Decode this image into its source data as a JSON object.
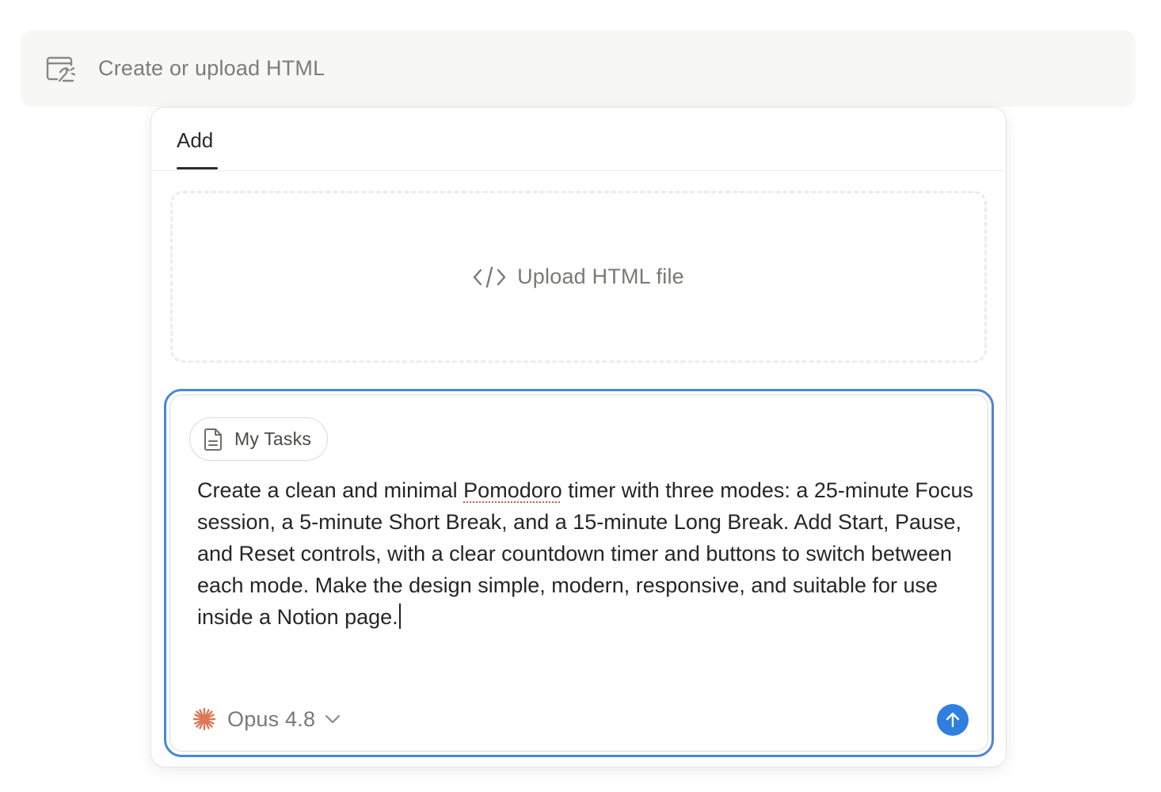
{
  "top_bar": {
    "icon": "html-embed-icon",
    "label": "Create or upload HTML"
  },
  "panel": {
    "tabs": [
      {
        "label": "Add",
        "active": true
      }
    ],
    "upload": {
      "icon": "code-icon",
      "label": "Upload HTML file"
    },
    "composer": {
      "context_chip": {
        "icon": "page-icon",
        "label": "My Tasks"
      },
      "prompt": {
        "before_spell": "Create a clean and minimal ",
        "spell_word": "Pomodoro",
        "after_spell": " timer with three modes: a 25-minute Focus session, a 5-minute Short Break, and a 15-minute Long Break. Add Start, Pause, and Reset controls, with a clear countdown timer and buttons to switch between each mode. Make the design simple, modern, responsive, and suitable for use inside a Notion page."
      },
      "model": {
        "icon": "sparkle-icon",
        "label": "Opus 4.8",
        "accent_color": "#d97757"
      },
      "send": {
        "icon": "arrow-up-icon",
        "color": "#2f7ee0"
      }
    }
  },
  "colors": {
    "focus_ring": "#4a86d8",
    "muted_text": "#7a7975",
    "top_bar_bg": "#f7f7f5"
  }
}
